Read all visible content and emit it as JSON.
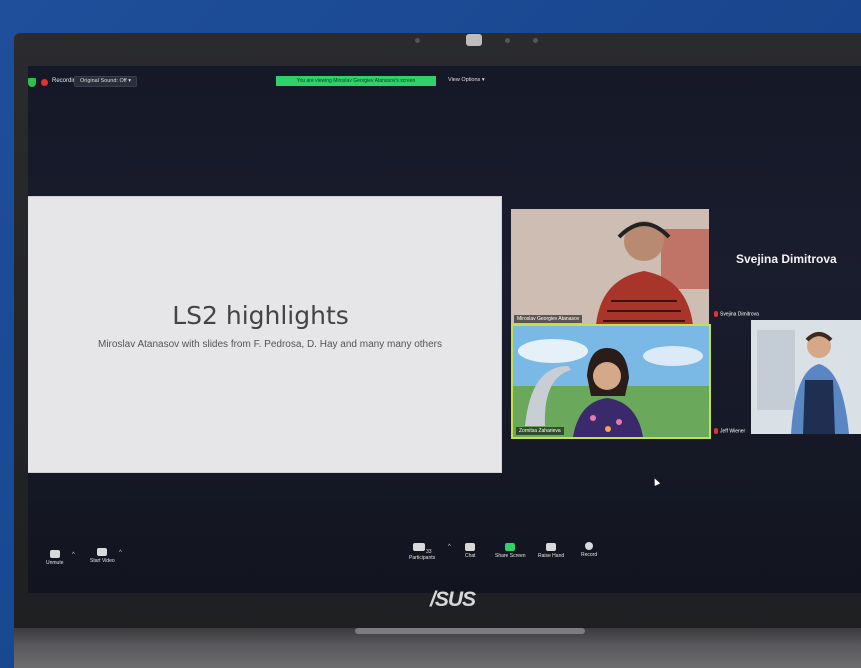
{
  "topbar": {
    "recording_label": "Recording",
    "sound_label": "Original Sound: Off",
    "banner_text": "You are viewing Miroslav Georgiev Atanasov's screen",
    "view_options_label": "View Options"
  },
  "slide": {
    "title": "LS2 highlights",
    "subtitle": "Miroslav Atanasov with slides from F. Pedrosa, D. Hay and many many others"
  },
  "participants": {
    "miroslav": "Miroslav Georgiev Atanasov",
    "zornitsa": "Zornitsa Zaharieva",
    "svejina_header": "Svejina Dimitrova",
    "svejina_tag": "Svejina Dimitrova",
    "jeff_tag": "Jeff Wiener"
  },
  "toolbar": {
    "unmute": "Unmute",
    "start_video": "Start Video",
    "participants": "Participants",
    "participants_count": "33",
    "chat": "Chat",
    "share_screen": "Share Screen",
    "raise_hand": "Raise Hand",
    "record": "Record"
  },
  "brand": {
    "logo": "/SUS"
  }
}
